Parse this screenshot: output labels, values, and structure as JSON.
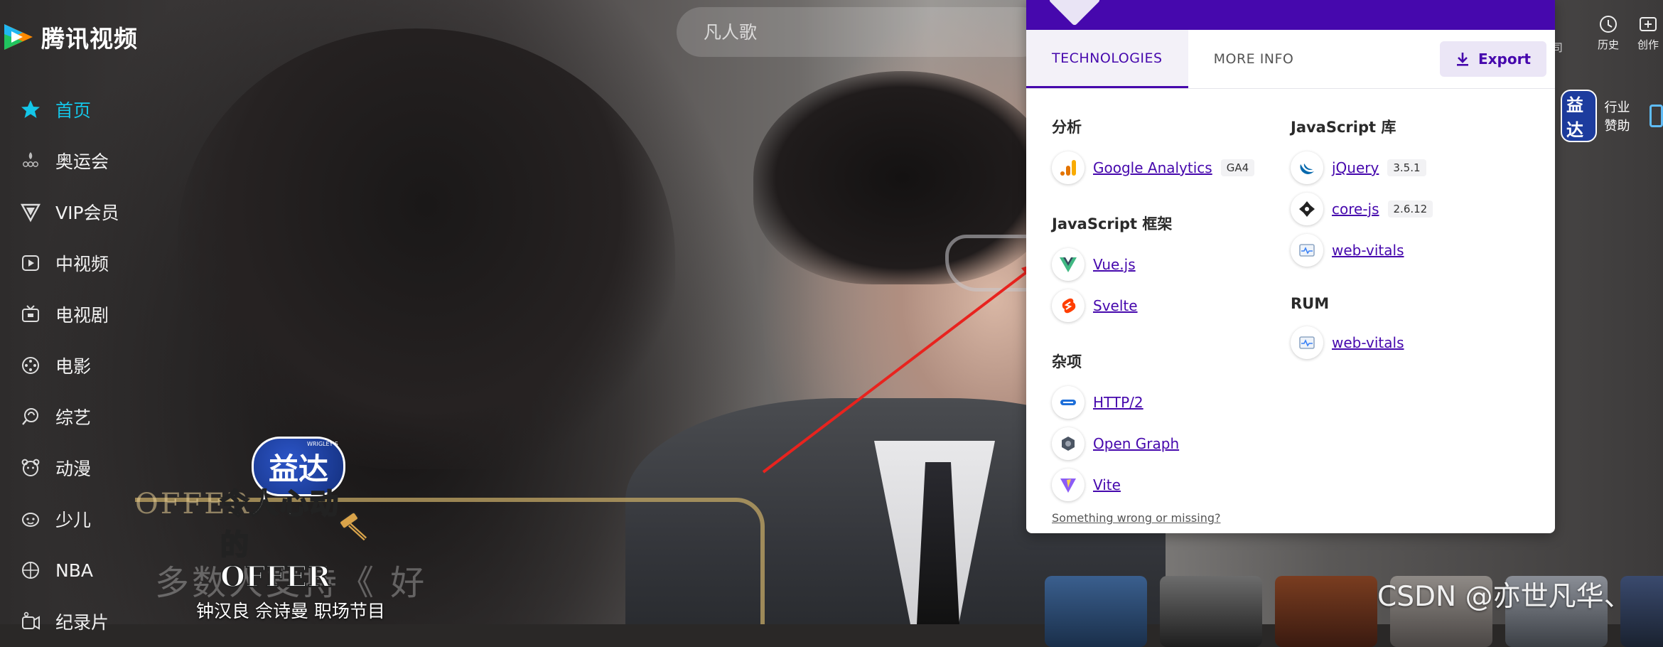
{
  "app": {
    "brand": "腾讯视频"
  },
  "search": {
    "placeholder": "凡人歌"
  },
  "top_icons": [
    {
      "icon": "history-icon",
      "label": "历史"
    },
    {
      "icon": "create-icon",
      "label": "创作"
    }
  ],
  "top_peek_text": "司",
  "sidebar": {
    "items": [
      {
        "icon": "star-icon",
        "label": "首页",
        "active": true
      },
      {
        "icon": "olympics-icon",
        "label": "奥运会"
      },
      {
        "icon": "vip-icon",
        "label": "VIP会员"
      },
      {
        "icon": "mid-video-icon",
        "label": "中视频"
      },
      {
        "icon": "tv-icon",
        "label": "电视剧"
      },
      {
        "icon": "film-icon",
        "label": "电影"
      },
      {
        "icon": "variety-icon",
        "label": "综艺"
      },
      {
        "icon": "anime-icon",
        "label": "动漫"
      },
      {
        "icon": "kids-icon",
        "label": "少儿"
      },
      {
        "icon": "nba-icon",
        "label": "NBA"
      },
      {
        "icon": "documentary-icon",
        "label": "纪录片"
      }
    ]
  },
  "promo": {
    "sponsor_logo": "益达",
    "sponsor_brand": "WRIGLEY'S",
    "show_title_cn": "令人心动的",
    "show_title_en": "OFFER",
    "ghost_offer": "OFFER",
    "ghost_line": "多数人支持《 好",
    "cast_line": "钟汉良 佘诗曼 职场节目"
  },
  "right_peek": {
    "logo": "益达",
    "label": "行业赞助"
  },
  "watermark": "CSDN @亦世凡华、",
  "popup": {
    "tabs": [
      {
        "label": "TECHNOLOGIES",
        "active": true
      },
      {
        "label": "MORE INFO",
        "active": false
      }
    ],
    "export_label": "Export",
    "columns": [
      [
        {
          "category": "分析",
          "techs": [
            {
              "name": "Google Analytics",
              "version": "GA4",
              "icon": "google-analytics-icon"
            }
          ]
        },
        {
          "category": "JavaScript 框架",
          "techs": [
            {
              "name": "Vue.js",
              "version": "",
              "icon": "vuejs-icon"
            },
            {
              "name": "Svelte",
              "version": "",
              "icon": "svelte-icon"
            }
          ]
        },
        {
          "category": "杂项",
          "techs": [
            {
              "name": "HTTP/2",
              "version": "",
              "icon": "http2-icon"
            },
            {
              "name": "Open Graph",
              "version": "",
              "icon": "open-graph-icon"
            },
            {
              "name": "Vite",
              "version": "",
              "icon": "vite-icon"
            }
          ]
        }
      ],
      [
        {
          "category": "JavaScript 库",
          "techs": [
            {
              "name": "jQuery",
              "version": "3.5.1",
              "icon": "jquery-icon"
            },
            {
              "name": "core-js",
              "version": "2.6.12",
              "icon": "corejs-icon"
            },
            {
              "name": "web-vitals",
              "version": "",
              "icon": "web-vitals-icon"
            }
          ]
        },
        {
          "category": "RUM",
          "techs": [
            {
              "name": "web-vitals",
              "version": "",
              "icon": "web-vitals-icon"
            }
          ]
        }
      ]
    ],
    "footer_link": "Something wrong or missing?"
  },
  "colors": {
    "accent": "#14c6e8",
    "wappalyzer_purple": "#4608ad",
    "arrow": "#e8231e"
  }
}
